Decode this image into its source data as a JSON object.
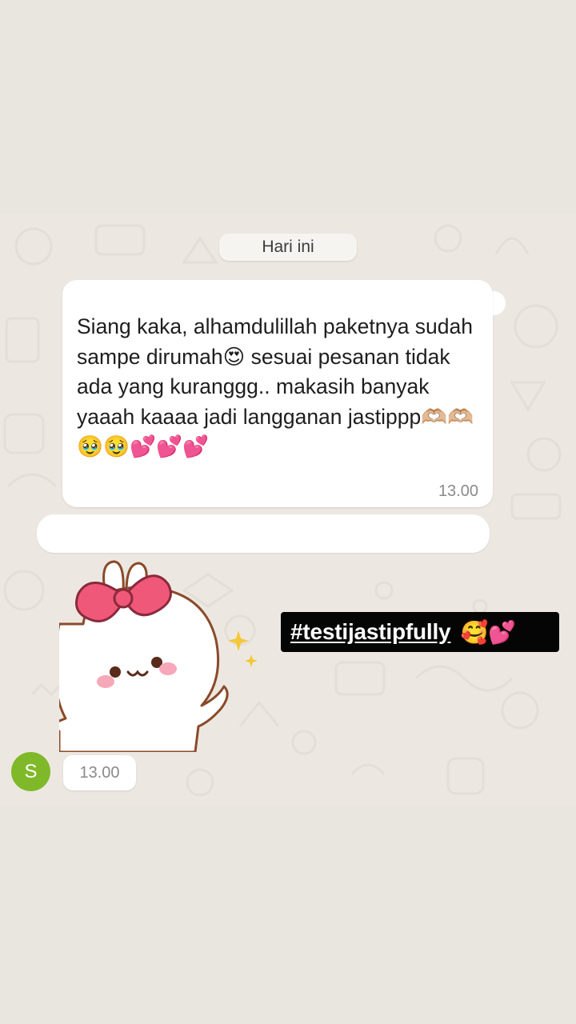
{
  "chat": {
    "date_separator": "Hari ini",
    "message": {
      "text": "Siang kaka, alhamdulillah paketnya sudah sampe dirumah😍 sesuai pesanan tidak ada yang kuranggg.. makasih banyak yaaah kaaaa jadi langganan jastippp🫶🏼🫶🏼🥹🥹💕💕💕",
      "time": "13.00"
    },
    "sticker": {
      "time": "13.00",
      "sender_initial": "S"
    }
  },
  "overlay": {
    "hashtag": "#testijastipfully",
    "hashtag_emojis": "🥰💕"
  },
  "colors": {
    "page_background": "#e9e6df",
    "chat_background": "#ece8e1",
    "bubble": "#ffffff",
    "avatar": "#7fb92a",
    "hashtag_background": "#050505"
  }
}
